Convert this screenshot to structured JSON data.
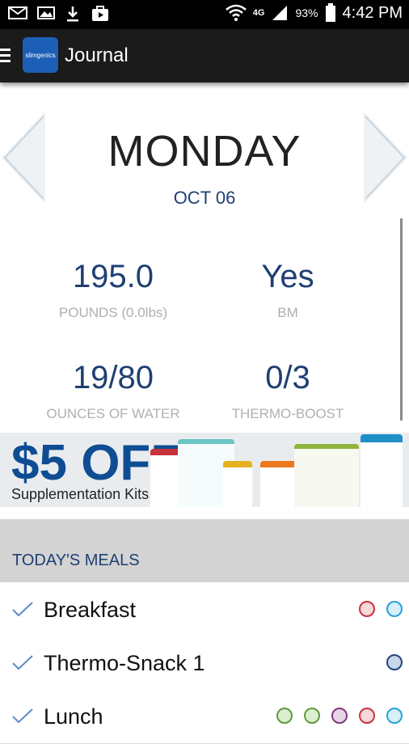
{
  "status_bar": {
    "battery": "93%",
    "time": "4:42 PM",
    "network": "4G"
  },
  "app_bar": {
    "title": "Journal",
    "logo_text": "slimgenics"
  },
  "day": {
    "name": "MONDAY",
    "date": "OCT 06"
  },
  "stats": [
    {
      "value": "195.0",
      "label": "POUNDS (0.0lbs)"
    },
    {
      "value": "Yes",
      "label": "BM"
    },
    {
      "value": "19/80",
      "label": "OUNCES OF WATER"
    },
    {
      "value": "0/3",
      "label": "THERMO-BOOST"
    }
  ],
  "banner": {
    "headline": "$5 OFF",
    "subtext": "Supplementation Kits"
  },
  "meals": {
    "header": "TODAY'S MEALS",
    "items": [
      {
        "name": "Breakfast",
        "dots": [
          "#c8323c",
          "#26a3d6"
        ]
      },
      {
        "name": "Thermo-Snack 1",
        "dots": [
          "#23437f"
        ]
      },
      {
        "name": "Lunch",
        "dots": [
          "#5c9a3a",
          "#5c9a3a",
          "#7b3a7a",
          "#c8323c",
          "#26a3d6"
        ]
      }
    ]
  }
}
